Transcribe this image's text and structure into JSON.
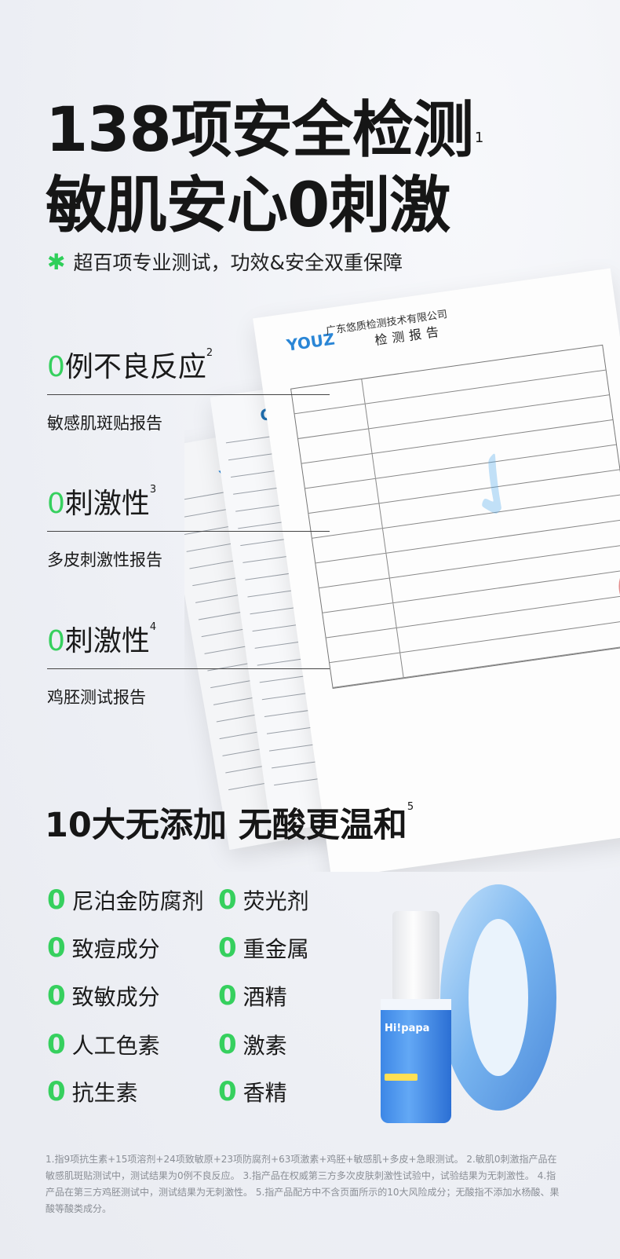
{
  "headline": {
    "line1": "138项安全检测",
    "line1_note": "1",
    "line2": "敏肌安心0刺激"
  },
  "subheadline": {
    "icon": "green-asterisk-icon",
    "text": "超百项专业测试，功效&安全双重保障"
  },
  "tests": [
    {
      "zero": "0",
      "title": "例不良反应",
      "note": "2",
      "desc": "敏感肌斑贴报告"
    },
    {
      "zero": "0",
      "title": "刺激性",
      "note": "3",
      "desc": "多皮刺激性报告"
    },
    {
      "zero": "0",
      "title": "刺激性",
      "note": "4",
      "desc": "鸡胚测试报告"
    }
  ],
  "report": {
    "logo": "YOUZ",
    "logo2": "CAS",
    "company": "广东悠质检测技术有限公司",
    "title": "检测报告"
  },
  "no_additive": {
    "title": "10大无添加  无酸更温和",
    "note": "5",
    "zero": "0",
    "left": [
      "尼泊金防腐剂",
      "致痘成分",
      "致敏成分",
      "人工色素",
      "抗生素"
    ],
    "right": [
      "荧光剂",
      "重金属",
      "酒精",
      "激素",
      "香精"
    ]
  },
  "product": {
    "brand": "Hi!papa"
  },
  "footnote": "1.指9项抗生素+15项溶剂+24项致敏原+23项防腐剂+63项激素+鸡胚+敏感肌+多皮+急眼测试。  2.敏肌0刺激指产品在敏感肌斑贴测试中，测试结果为0例不良反应。 3.指产品在权威第三方多次皮肤刺激性试验中，试验结果为无刺激性。  4.指产品在第三方鸡胚测试中，测试结果为无刺激性。 5.指产品配方中不含页面所示的10大风险成分；无酸指不添加水杨酸、果酸等酸类成分。",
  "colors": {
    "accent": "#36d05e",
    "background": "#eef0f5"
  }
}
